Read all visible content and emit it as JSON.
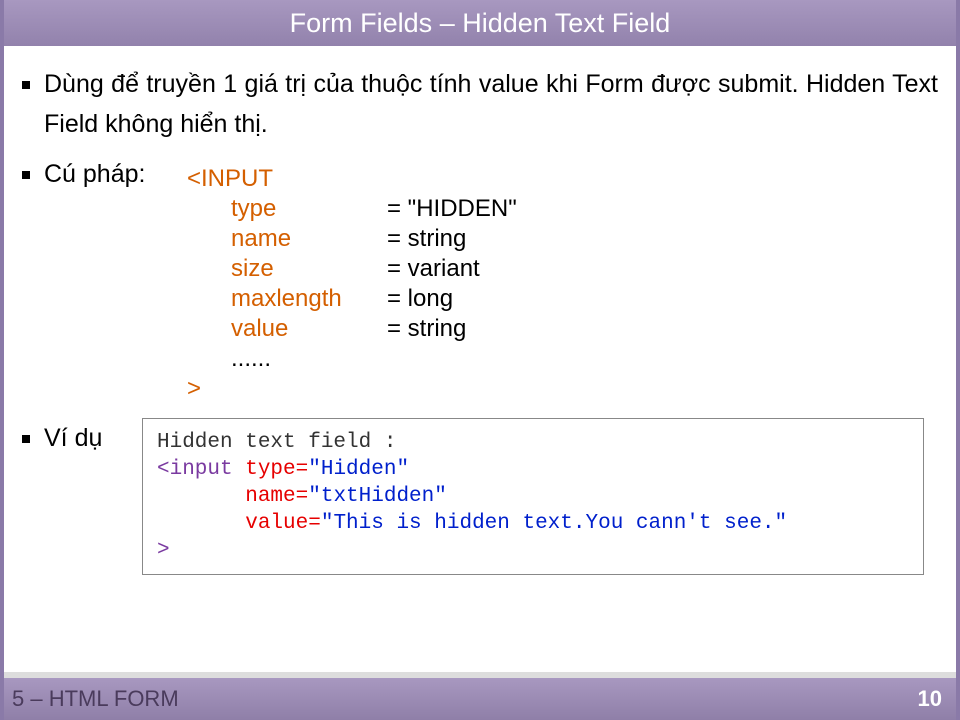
{
  "title": "Form Fields – Hidden Text Field",
  "bullets": {
    "desc": "Dùng để truyền 1 giá trị của thuộc tính value khi Form được submit. Hidden Text Field không hiển thị.",
    "syntax_label": "Cú pháp:",
    "example_label": "Ví dụ"
  },
  "syntax": {
    "open": "<INPUT",
    "rows": [
      {
        "key": "type",
        "val": "= \"HIDDEN\""
      },
      {
        "key": "name",
        "val": "= string"
      },
      {
        "key": "size",
        "val": "= variant"
      },
      {
        "key": "maxlength",
        "val": "= long"
      },
      {
        "key": "value",
        "val": "= string"
      }
    ],
    "dots": "......",
    "close": ">"
  },
  "example": {
    "line1": "Hidden text field :",
    "tag_open": "<input ",
    "attr_type": "type=",
    "val_type": "\"Hidden\"",
    "attr_name": "name=",
    "val_name": "\"txtHidden\"",
    "attr_value": "value=",
    "val_value": "\"This is hidden text.You cann't see.\"",
    "tag_close": ">"
  },
  "footer": {
    "left": "5 – HTML FORM",
    "right": "10"
  }
}
